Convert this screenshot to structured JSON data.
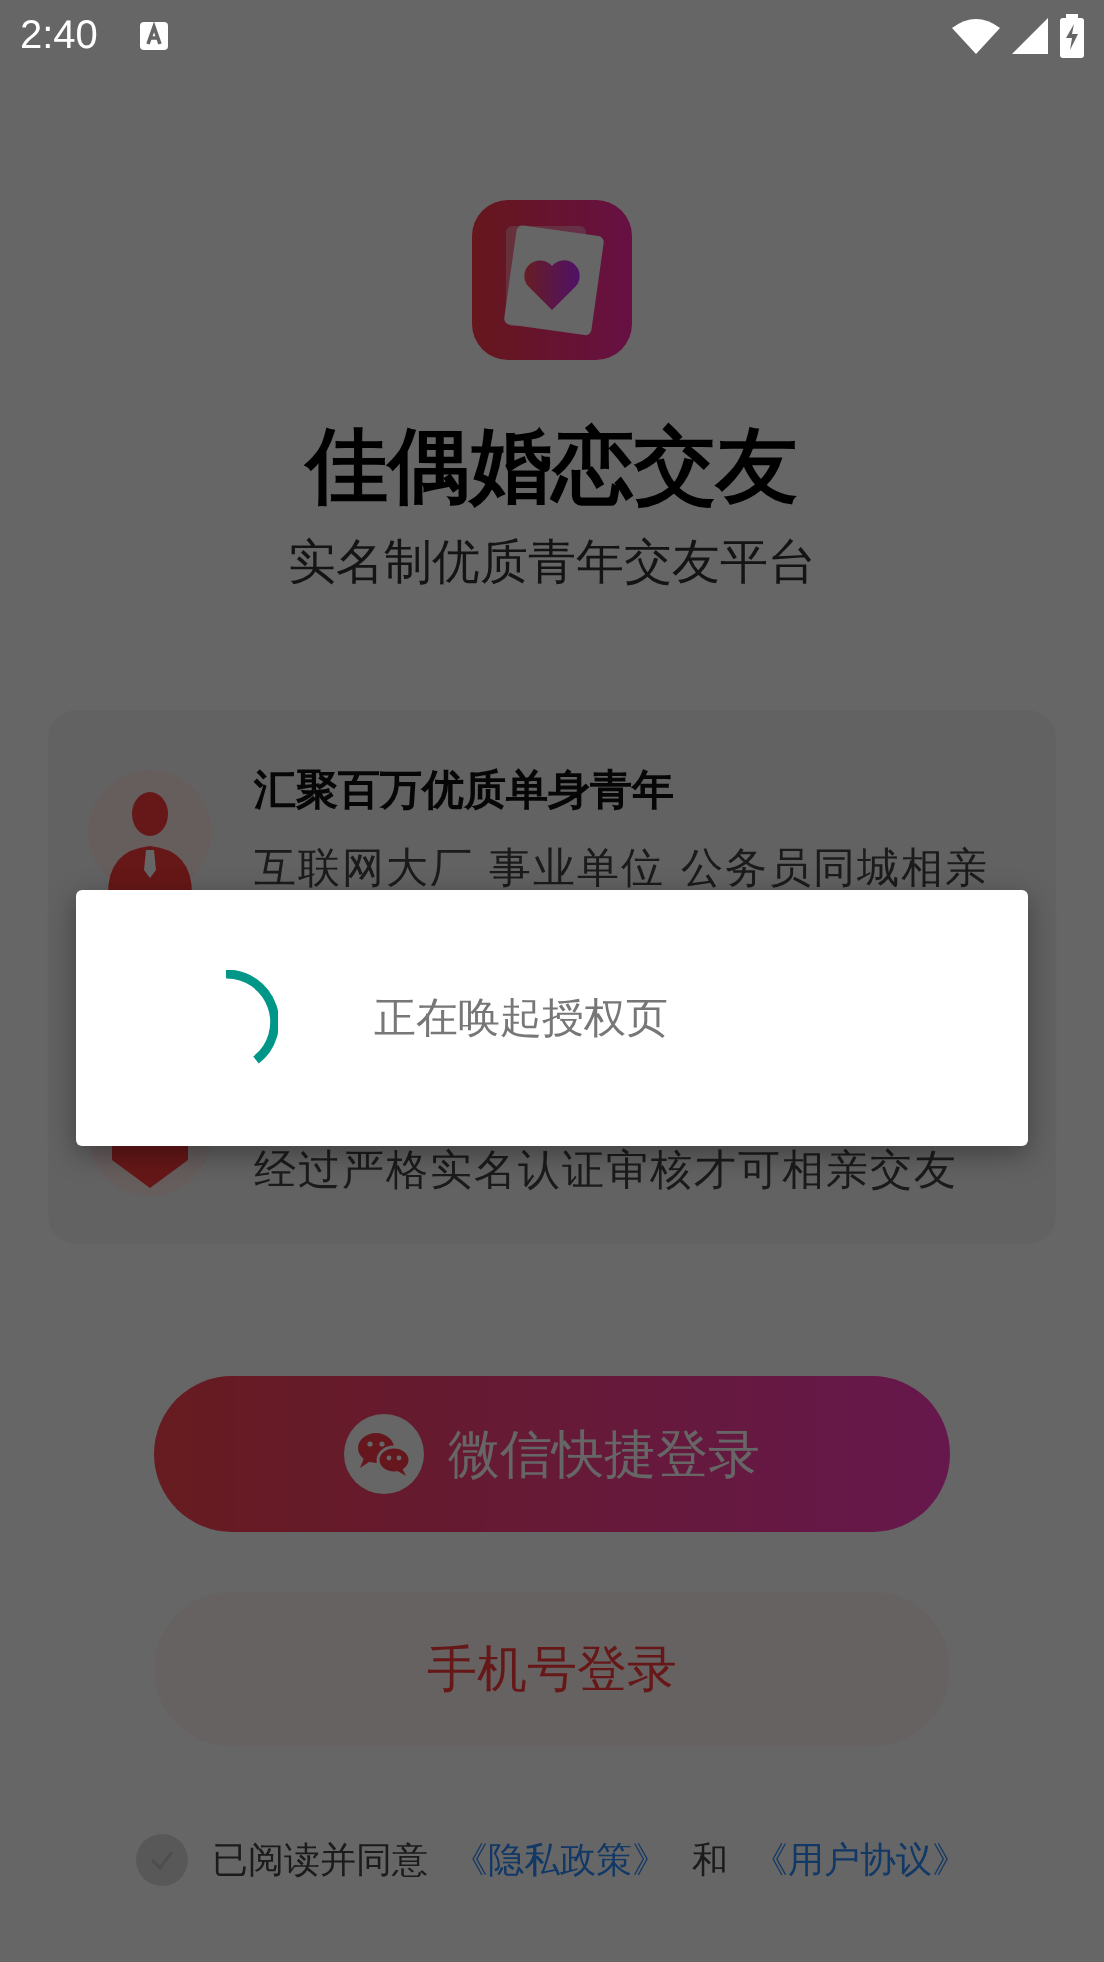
{
  "status_bar": {
    "time": "2:40"
  },
  "app": {
    "name": "佳偶婚恋交友",
    "slogan": "实名制优质青年交友平台"
  },
  "features": [
    {
      "kind": "person",
      "title": "汇聚百万优质单身青年",
      "description": "互联网大厂 事业单位 公务员同城相亲"
    },
    {
      "kind": "badge",
      "description": "经过严格实名认证审核才可相亲交友"
    }
  ],
  "buttons": [
    {
      "kind": "wechat",
      "label": "微信快捷登录"
    },
    {
      "kind": "phone",
      "label": "手机号登录"
    }
  ],
  "agreement": {
    "checked": false,
    "text": "已阅读并同意",
    "privacy_link": "《隐私政策》",
    "conjunction": "和",
    "terms_link": "《用户协议》"
  },
  "dialog": {
    "message": "正在唤起授权页"
  }
}
